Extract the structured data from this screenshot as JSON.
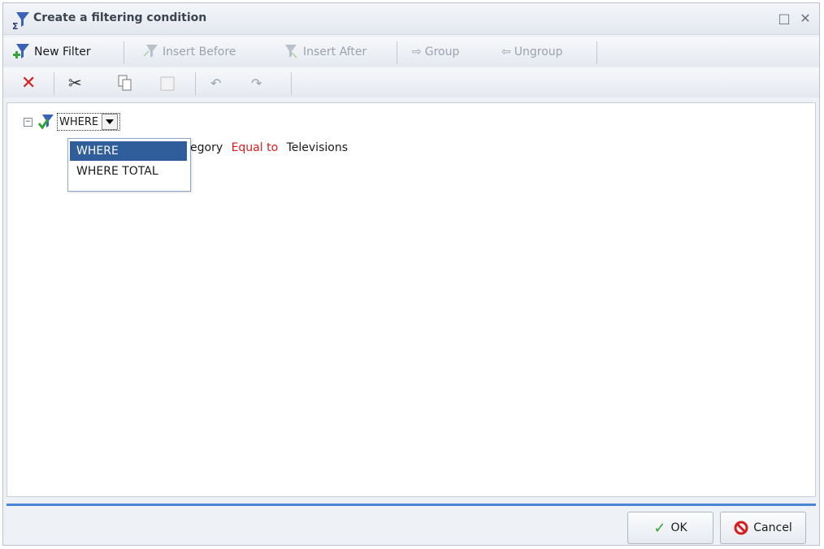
{
  "dialog": {
    "title": "Create a filtering condition",
    "maximize_glyph": "□",
    "close_glyph": "✕"
  },
  "toolbar1": {
    "new_filter": "New Filter",
    "insert_before": "Insert Before",
    "insert_after": "Insert After",
    "group": "Group",
    "ungroup": "Ungroup"
  },
  "toolbar2": {
    "icons": [
      "delete-icon",
      "cut-icon",
      "copy-icon",
      "paste-icon",
      "undo-icon",
      "redo-icon"
    ]
  },
  "tree": {
    "collapse_glyph": "−",
    "where_value": "WHERE",
    "condition_field_partial": "egory",
    "operator": "Equal to",
    "value": "Televisions"
  },
  "dropdown": {
    "options": [
      "WHERE",
      "WHERE TOTAL"
    ],
    "selected": "WHERE"
  },
  "footer": {
    "ok": "OK",
    "cancel": "Cancel"
  },
  "colors": {
    "accent_blue": "#4a86d8",
    "operator_red": "#e01b1b",
    "selection_blue": "#2f5e9a"
  }
}
